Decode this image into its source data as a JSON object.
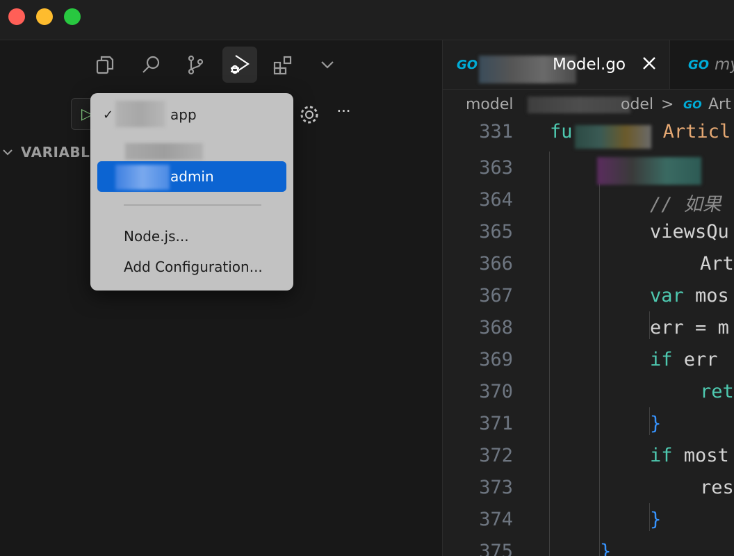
{
  "window": {
    "traffic_lights": {
      "close": "#ff5f57",
      "minimize": "#febc2e",
      "maximize": "#28c840"
    }
  },
  "activity_bar": {
    "icons": [
      "explorer-icon",
      "search-icon",
      "source-control-icon",
      "run-debug-icon",
      "extensions-icon",
      "chevron-down-icon"
    ],
    "active": "run-debug-icon"
  },
  "debug_toolbar": {
    "start_icon": "▷",
    "more_label": "···"
  },
  "variables_panel": {
    "label": "VARIABL"
  },
  "launch_menu": {
    "items": [
      {
        "label": "app",
        "checked": true,
        "check_mark": "✓"
      },
      {
        "label": "admin",
        "selected": true
      },
      {
        "label": "Node.js..."
      },
      {
        "label": "Add Configuration..."
      }
    ],
    "selected_color": "#0c64d2"
  },
  "editor": {
    "tabs": [
      {
        "icon": "GO",
        "label": "Model.go",
        "active": true
      },
      {
        "icon": "GO",
        "label": "my",
        "active": false
      }
    ],
    "breadcrumb": {
      "first": "model",
      "second": "odel",
      "separator": ">",
      "icon": "GO",
      "symbol": "Art"
    },
    "lines": [
      {
        "num": "331",
        "tokens": [
          {
            "t": "fu",
            "c": "kw"
          },
          {
            "t": "        ",
            "c": "var"
          },
          {
            "t": "Articl",
            "c": "type"
          }
        ]
      },
      {
        "num": "363",
        "tokens": []
      },
      {
        "num": "364",
        "tokens": [
          {
            "t": "// 如果",
            "c": "cmt"
          }
        ]
      },
      {
        "num": "365",
        "tokens": [
          {
            "t": "viewsQu",
            "c": "var"
          }
        ]
      },
      {
        "num": "366",
        "tokens": [
          {
            "t": "Art",
            "c": "var"
          }
        ]
      },
      {
        "num": "367",
        "tokens": [
          {
            "t": "var",
            "c": "kw"
          },
          {
            "t": " mos",
            "c": "var"
          }
        ]
      },
      {
        "num": "368",
        "tokens": [
          {
            "t": "err",
            "c": "var"
          },
          {
            "t": " = ",
            "c": "op"
          },
          {
            "t": "m",
            "c": "var"
          }
        ]
      },
      {
        "num": "369",
        "tokens": [
          {
            "t": "if",
            "c": "kw"
          },
          {
            "t": " err",
            "c": "var"
          }
        ]
      },
      {
        "num": "370",
        "tokens": [
          {
            "t": "ret",
            "c": "kw"
          }
        ]
      },
      {
        "num": "371",
        "tokens": [
          {
            "t": "}",
            "c": "brace"
          }
        ]
      },
      {
        "num": "372",
        "tokens": [
          {
            "t": "if",
            "c": "kw"
          },
          {
            "t": " most",
            "c": "var"
          }
        ]
      },
      {
        "num": "373",
        "tokens": [
          {
            "t": "res",
            "c": "var"
          }
        ]
      },
      {
        "num": "374",
        "tokens": [
          {
            "t": "}",
            "c": "brace"
          }
        ]
      },
      {
        "num": "375",
        "tokens": [
          {
            "t": "}",
            "c": "brace"
          }
        ]
      }
    ]
  }
}
